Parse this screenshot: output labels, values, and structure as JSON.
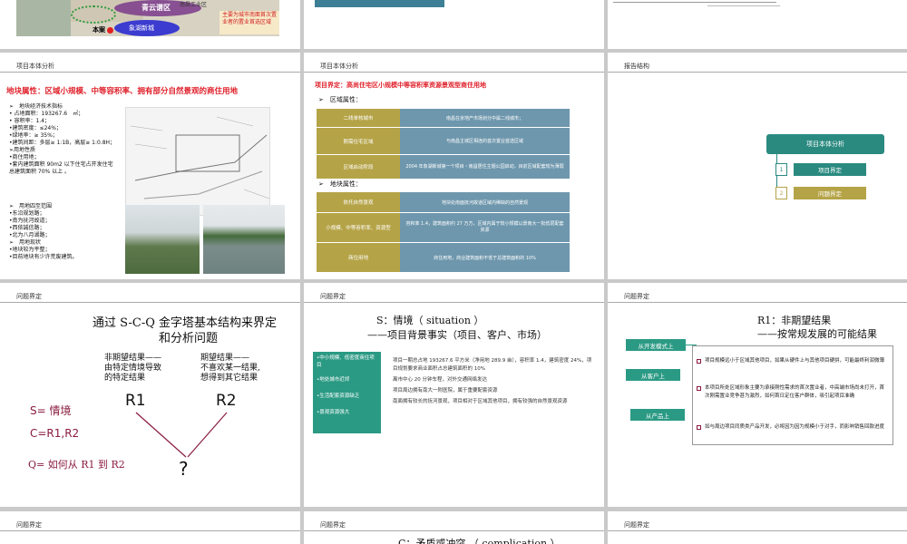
{
  "row1": {
    "s1": {
      "labels": [
        "青云谱区",
        "本案",
        "象湖新城",
        "南昌工业区"
      ],
      "caption": "主要为城市南面首次置业者的置业首选区域"
    },
    "s2": {},
    "s3": {}
  },
  "row2": {
    "s4": {
      "header": "项目本体分析",
      "title": "地块属性：区域小规模、中等容积率、拥有部分自然景观的商住用地",
      "specs": [
        "➢　地块经济技术指标",
        "•  占地面积：193267.6　㎡；",
        "•  容积率：1.4；",
        "•建筑密度：≤24%；",
        "•绿地率：≥ 35%；",
        "•建筑间距：多层≥ 1:1B，高层≥ 1:0.8H；",
        "➢用地性质",
        "•商住用地；",
        "•套内建筑面积 90m2 以下住宅占开发住宅总建筑面积 70% 以上 。"
      ],
      "surround": [
        "➢　用地四至范围",
        "•东沿规划路；",
        "•南为抚河故道；",
        "•西依誠信路；",
        "•北为八月湖路；",
        "➢　用地现状",
        "•地块较为平整；",
        "•目前地块有少许荒废建筑。"
      ]
    },
    "s5": {
      "header": "项目本体分析",
      "title": "项目界定：高尚住宅区小规模中等容积率资源景观型商住用地",
      "sec1": "➢　区域属性：",
      "rows1": [
        {
          "k": "二线单核城市",
          "v": "南昌在京地产市场划分中属二线城市；"
        },
        {
          "k": "刚需住宅区域",
          "v": "与南昌主城区相连的首次置业首选区域"
        },
        {
          "k": "区域启动阶段",
          "v": "2004 年象湖新城第一个项目・南昌居住主题公园启动，目前区域配套较为薄弱"
        }
      ],
      "sec2": "➢　地块属性：",
      "rows2": [
        {
          "k": "依托自然景观",
          "v": "地块处南面抚河故道区域内稀缺的自然景观"
        },
        {
          "k": "小规模、中等容积率、资源型",
          "v": "容积率 1.4，建筑面积约 27 万方，区域内属于较小规模以景南大一批低层配套资源"
        },
        {
          "k": "商住用地",
          "v": "商住用地，商业建筑面积不低于总建筑面积的 10%"
        }
      ]
    },
    "s6": {
      "header": "报告结构",
      "main": "项目本体分析",
      "items": [
        {
          "n": "1",
          "label": "项目界定"
        },
        {
          "n": "2",
          "label": "问题界定"
        }
      ]
    }
  },
  "row3": {
    "s7": {
      "header": "问题界定",
      "title1": "通过 S-C-Q 金字塔基本结构来界定",
      "title2": "和分析问题",
      "left": [
        "非期望结果——",
        "由特定情境导致",
        "的特定结果"
      ],
      "right": [
        "期望结果——",
        "不喜欢某一结果,",
        "想得到其它结果"
      ],
      "r1": "R1",
      "r2": "R2",
      "q": "?",
      "s": "S= 情境",
      "c": "C=R1,R2",
      "qdef": "Q= 如何从 R1 到 R2"
    },
    "s8": {
      "header": "问题界定",
      "title1": "S：情境（ situation ）",
      "title2": "——项目背景事实（项目、客户、市场）",
      "tags": [
        "•中小规模、低密度商住项目",
        "•地处城市近郊",
        "•生活配套资源缺乏",
        "•景观资源强大"
      ],
      "points": [
        "项目一期总占地 193267.6 平方米（净用地 289.9 亩），容积率 1.4，建筑密度 24%，项目规划要求商业面积占总建筑面积的 10%",
        "离市中心 20 分钟车程，对外交通网络发达",
        "项目周边拥有南大一附医院，属于重要配套资源",
        "南面拥有较长的抚河景观，项目相对于区域其他项目，拥有较强的自然景观资源"
      ]
    },
    "s9": {
      "header": "问题界定",
      "title1": "R1：非期望结果",
      "title2": "——按常规发展的可能结果",
      "tags": [
        "从开发模式上",
        "从客户上",
        "从产品上"
      ],
      "points": [
        "项目规模远小于区域其他项目，如果从硬件上与其他项目硬拼，可能最终利润微薄",
        "本项目所处区域形象主要为承接刚性需求的首次置业者，中高端市场尚未打开，首次刚需置业竞争甚为激烈，如何首日定位客户群体，吸引起项目准确",
        "如与周边项目同质类产品开发，必将因为因为规模小于对手，而影响销售回款进度"
      ]
    }
  },
  "row4": {
    "s10": {
      "header": "问题界定"
    },
    "s11": {
      "header": "问题界定",
      "title": "C：矛盾或冲突 （ complication ）"
    },
    "s12": {
      "header": "问题界定"
    }
  }
}
